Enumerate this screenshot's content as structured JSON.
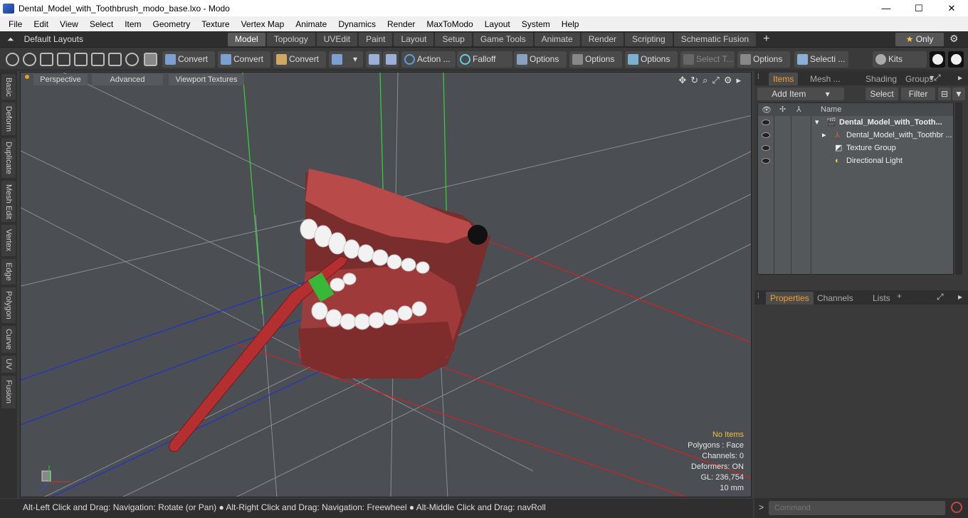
{
  "window": {
    "title": "Dental_Model_with_Toothbrush_modo_base.lxo - Modo",
    "min": "—",
    "max": "☐",
    "close": "✕"
  },
  "menu": [
    "File",
    "Edit",
    "View",
    "Select",
    "Item",
    "Geometry",
    "Texture",
    "Vertex Map",
    "Animate",
    "Dynamics",
    "Render",
    "MaxToModo",
    "Layout",
    "System",
    "Help"
  ],
  "layouts": {
    "label": "Default Layouts",
    "arrow": "▾"
  },
  "tabs": [
    "Model",
    "Topology",
    "UVEdit",
    "Paint",
    "Layout",
    "Setup",
    "Game Tools",
    "Animate",
    "Render",
    "Scripting",
    "Schematic Fusion"
  ],
  "active_tab": "Model",
  "only": {
    "star": "★",
    "label": "Only"
  },
  "toolbar": {
    "convert1": "Convert",
    "convert2": "Convert",
    "convert3": "Convert",
    "action": "Action ...",
    "falloff": "Falloff",
    "options1": "Options",
    "options2": "Options",
    "options3": "Options",
    "select_t": "Select T...",
    "options4": "Options",
    "selecti": "Selecti ...",
    "kits": "Kits"
  },
  "left_tabs": [
    "Basic",
    "Deform",
    "Duplicate",
    "Mesh Edit",
    "Vertex",
    "Edge",
    "Polygon",
    "Curve",
    "UV",
    "Fusion"
  ],
  "viewport": {
    "perspective": "Perspective",
    "advanced": "Advanced",
    "textures": "Viewport Textures",
    "info": {
      "no_items": "No Items",
      "polygons": "Polygons : Face",
      "channels": "Channels: 0",
      "deformers": "Deformers: ON",
      "gl": "GL: 236,754",
      "scale": "10 mm"
    }
  },
  "status": "Alt-Left Click and Drag: Navigation: Rotate (or Pan) ● Alt-Right Click and Drag: Navigation: Freewheel ● Alt-Middle Click and Drag: navRoll",
  "items_panel": {
    "tabs": [
      "Items",
      "Mesh ...",
      "Shading",
      "Groups"
    ],
    "add_item": "Add Item",
    "select": "Select",
    "filter": "Filter",
    "col_name": "Name",
    "rows": [
      {
        "label": "Dental_Model_with_Tooth...",
        "indent": 0
      },
      {
        "label": "Dental_Model_with_Toothbr ...",
        "indent": 1
      },
      {
        "label": "Texture Group",
        "indent": 1
      },
      {
        "label": "Directional Light",
        "indent": 1
      }
    ]
  },
  "properties_panel": {
    "tabs": [
      "Properties",
      "Channels",
      "Lists"
    ]
  },
  "command": {
    "placeholder": "Command"
  }
}
